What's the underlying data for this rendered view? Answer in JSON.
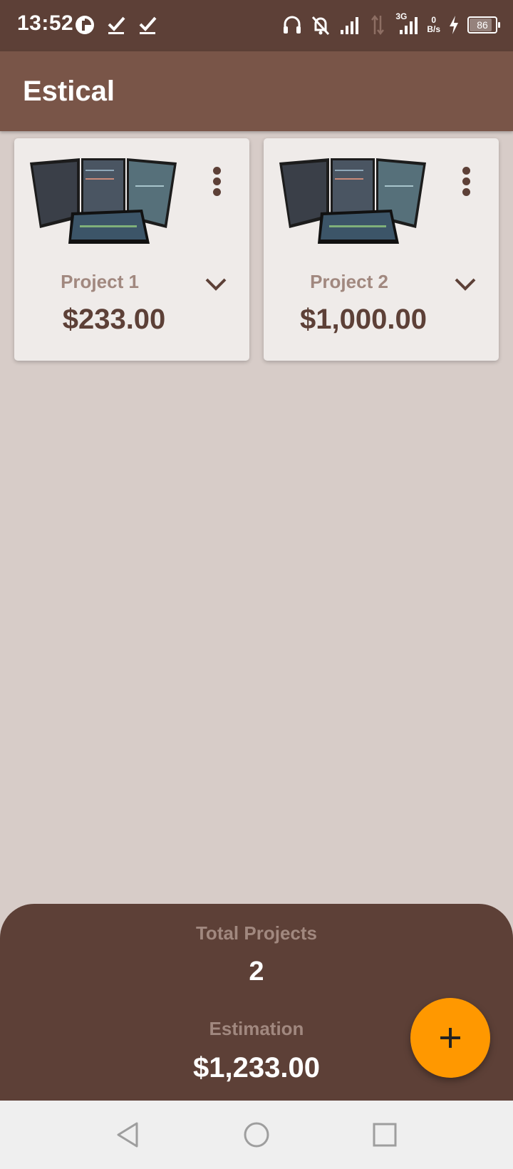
{
  "status_bar": {
    "time": "13:52",
    "network_type": "3G",
    "net_speed_value": "0",
    "net_speed_unit": "B/s",
    "battery": "86",
    "icons": [
      "pie-app-icon",
      "check-icon",
      "check-icon",
      "headset-icon",
      "bell-off-icon",
      "signal-icon",
      "data-arrows-icon",
      "signal-3g-icon",
      "charging-icon",
      "battery-icon"
    ]
  },
  "app_bar": {
    "title": "Estical"
  },
  "projects": [
    {
      "name": "Project 1",
      "price": "$233.00"
    },
    {
      "name": "Project 2",
      "price": "$1,000.00"
    }
  ],
  "summary": {
    "total_label": "Total Projects",
    "total_value": "2",
    "estimation_label": "Estimation",
    "estimation_value": "$1,233.00"
  },
  "fab": {
    "icon": "plus-icon"
  },
  "nav_bar": {
    "icons": [
      "back-icon",
      "home-icon",
      "recents-icon"
    ]
  },
  "colors": {
    "primary_dark": "#5d4037",
    "primary": "#795548",
    "background": "#d7ccc8",
    "card": "#efebe9",
    "muted_text": "#a1887f",
    "accent": "#ff9800"
  }
}
